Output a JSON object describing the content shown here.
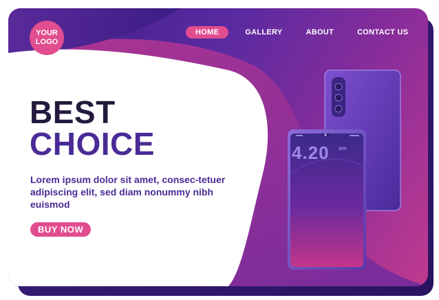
{
  "logo": {
    "text": "YOUR\nLOGO"
  },
  "nav": {
    "items": [
      {
        "label": "HOME",
        "active": true
      },
      {
        "label": "GALLERY",
        "active": false
      },
      {
        "label": "ABOUT",
        "active": false
      },
      {
        "label": "CONTACT US",
        "active": false
      }
    ]
  },
  "hero": {
    "headline_line1": "BEST",
    "headline_line2": "CHOICE",
    "body": "Lorem ipsum dolor sit amet, consec-tetuer adipiscing elit, sed diam nonummy nibh euismod",
    "cta_label": "BUY NOW"
  },
  "phone": {
    "time": "4.20",
    "ampm": "am"
  },
  "colors": {
    "accent": "#e14d8e",
    "dark_text": "#241a3d",
    "purple_text": "#4a2b96"
  }
}
